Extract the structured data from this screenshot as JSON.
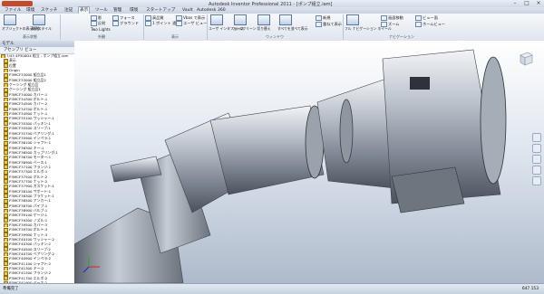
{
  "window": {
    "title": "Autodesk Inventor Professional 2011 - [ポンプ組立.iam]",
    "controls": [
      "–",
      "□",
      "×"
    ]
  },
  "menu": {
    "tabs": [
      "ファイル",
      "環境",
      "スケッチ",
      "注記",
      "表示",
      "ツール",
      "管理",
      "環境",
      "スタートアップ",
      "Vault",
      "Autodesk 360"
    ],
    "active_index": 4
  },
  "ribbon": {
    "panels": [
      {
        "label": "表示状態",
        "items": [
          "オブジェクトの表示状態",
          "表示スタイル"
        ]
      },
      {
        "label": "外観",
        "items": [
          "影",
          "反射",
          "フォース",
          "グラウンド",
          "Two Lights"
        ]
      },
      {
        "label": "表示",
        "items": [
          "高品質",
          "1 ポイント 遠近",
          "Vbas で表示",
          "ユーザ ビュー"
        ]
      },
      {
        "label": "ウィンドウ",
        "items": [
          "ユーザ インタフェース",
          "フルスクリーン",
          "切り替え",
          "すべてを並べて表示",
          "新規",
          "重ねて表示"
        ]
      },
      {
        "label": "ナビゲーション",
        "items": [
          "フル ナビゲーション ホイール",
          "画面移動",
          "ズーム",
          "ビュー面",
          "ホームビュー"
        ]
      }
    ]
  },
  "browser": {
    "title": "モデル",
    "toolbar_label": "アセンブリ ビュー",
    "root": "7/43 4P300D4 組立 - ポンプ組立.iam",
    "items": [
      "表示",
      "位置",
      "Origin",
      "P3MCF33000 組立品1",
      "P3MCF33000 組立品2",
      "ケーシング 組立品",
      "ケーシング 組立品1",
      "P3MCF34000 カバー:1",
      "P3MCF34300 ボルト:1",
      "P3MCF34500 カバー:2",
      "P3MCF34700 ボルト:1",
      "P3MCF34900 ナット:1",
      "P3MCF35100 ワッシャー:1",
      "P3MCF35300 パッキン:1",
      "P3MCF35500 スリーブ:1",
      "P3MCF35700 ベアリング:1",
      "P3MCF35900 インペラ:1",
      "P3MCF36100 シャフト:1",
      "P3MCF36300 キー:1",
      "P3MCF36500 カップリング:1",
      "P3MCF36700 モーター:1",
      "P3MCF36900 ベース:1",
      "P3MCF37100 フランジ:1",
      "P3MCF37300 エルボ:1",
      "P3MCF37500 ボルト:2",
      "P3MCF37700 ナット:2",
      "P3MCF37900 ガスケット:1",
      "P3MCF38100 サポート:1",
      "P3MCF38300 ブラケット:1",
      "P3MCF38500 アンカー:1",
      "P3MCF38700 パイプ:1",
      "P3MCF38900 バルブ:1",
      "P3MCF39100 ゲージ:1",
      "P3MCF39300 ノズル:1",
      "P3MCF39500 カバー:3",
      "P3MCF39700 ボルト:3",
      "P3MCF39900 ナット:3",
      "P3MCF40100 ワッシャー:2",
      "P3MCF40300 パッキン:2",
      "P3MCF40500 スリーブ:2",
      "P3MCF40700 ベアリング:2",
      "P3MCF40900 インペラ:2",
      "P3MCF41100 シャフト:2",
      "P3MCF41300 キー:2",
      "P3MCF41500 フランジ:2",
      "P3MCF41700 エルボ:2",
      "P3MCF41900 ベース:2",
      "P3MCF42100 サポート:2"
    ]
  },
  "status": {
    "left": "準備完了",
    "right": "647  153"
  }
}
